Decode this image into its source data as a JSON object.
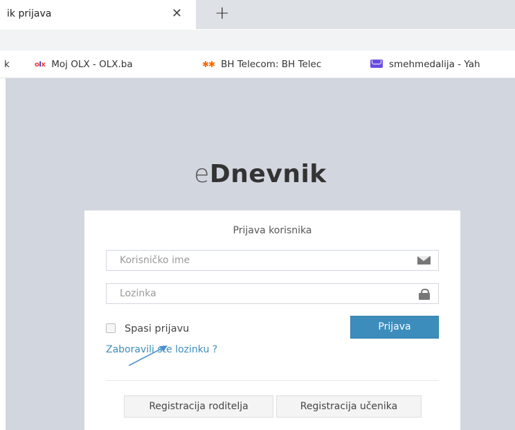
{
  "browser": {
    "tab_title": "ik prijava",
    "tab_close": "✕",
    "new_tab": "+",
    "bookmarks": [
      {
        "label": "k"
      },
      {
        "label": "Moj OLX - OLX.ba"
      },
      {
        "label": "BH Telecom: BH Telec"
      },
      {
        "label": "smehmedalija - Yah"
      }
    ],
    "olx_icon": "olx"
  },
  "page": {
    "logo_light": "e",
    "logo_bold": "Dnevnik",
    "heading": "Prijava korisnika",
    "username_placeholder": "Korisničko ime",
    "password_placeholder": "Lozinka",
    "remember_label": "Spasi prijavu",
    "login_label": "Prijava",
    "forgot_label": "Zaboravili ste lozinku ?",
    "register_parent_label": "Registracija roditelja",
    "register_student_label": "Registracija učenika"
  },
  "icons": {
    "username_field": "envelope-icon",
    "password_field": "lock-icon",
    "annotation": "arrow-annotation"
  },
  "colors": {
    "primary": "#3c8dbc",
    "page_background": "#d2d6de",
    "annotation_arrow": "#4a8fd0"
  }
}
